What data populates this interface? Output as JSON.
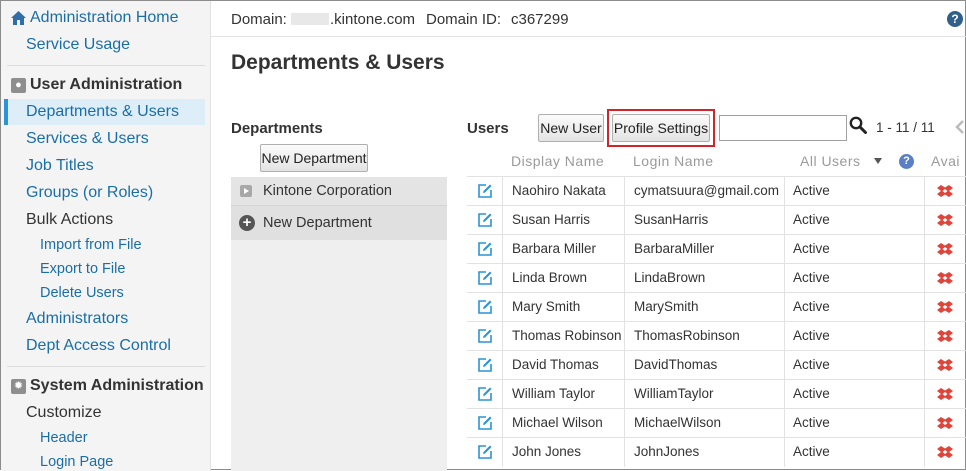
{
  "sidebar": {
    "admin_home": "Administration Home",
    "service_usage": "Service Usage",
    "user_admin_section": "User Administration",
    "departments_users": "Departments & Users",
    "services_users": "Services & Users",
    "job_titles": "Job Titles",
    "groups_roles": "Groups (or Roles)",
    "bulk_actions": "Bulk Actions",
    "import_from_file": "Import from File",
    "export_to_file": "Export to File",
    "delete_users": "Delete Users",
    "administrators": "Administrators",
    "dept_access_control": "Dept Access Control",
    "system_admin_section": "System Administration",
    "customize": "Customize",
    "header": "Header",
    "login_page": "Login Page"
  },
  "header": {
    "domain_label": "Domain:",
    "domain_suffix": ".kintone.com",
    "domain_id_label": "Domain ID:",
    "domain_id": "c367299"
  },
  "page_title": "Departments & Users",
  "departments": {
    "title": "Departments",
    "new_department_button": "New Department",
    "items": [
      "Kintone Corporation",
      "New Department"
    ]
  },
  "users": {
    "title": "Users",
    "new_user_button": "New User",
    "profile_settings_button": "Profile Settings",
    "search_value": "",
    "page_count": "1 - 11 / 11",
    "columns": {
      "display_name": "Display Name",
      "login_name": "Login Name",
      "status_filter": "All Users",
      "available": "Avai"
    },
    "rows": [
      {
        "display_name": "Naohiro Nakata",
        "login_name": "cymatsuura@gmail.com",
        "status": "Active"
      },
      {
        "display_name": "Susan Harris",
        "login_name": "SusanHarris",
        "status": "Active"
      },
      {
        "display_name": "Barbara Miller",
        "login_name": "BarbaraMiller",
        "status": "Active"
      },
      {
        "display_name": "Linda Brown",
        "login_name": "LindaBrown",
        "status": "Active"
      },
      {
        "display_name": "Mary Smith",
        "login_name": "MarySmith",
        "status": "Active"
      },
      {
        "display_name": "Thomas Robinson",
        "login_name": "ThomasRobinson",
        "status": "Active"
      },
      {
        "display_name": "David Thomas",
        "login_name": "DavidThomas",
        "status": "Active"
      },
      {
        "display_name": "William Taylor",
        "login_name": "WilliamTaylor",
        "status": "Active"
      },
      {
        "display_name": "Michael Wilson",
        "login_name": "MichaelWilson",
        "status": "Active"
      },
      {
        "display_name": "John Jones",
        "login_name": "JohnJones",
        "status": "Active"
      }
    ]
  },
  "colors": {
    "link": "#1a6ea8",
    "highlight": "#d0262b",
    "active_bg": "#ddeef8",
    "edit_icon": "#2a94d6",
    "avail_icon": "#e0453c"
  }
}
